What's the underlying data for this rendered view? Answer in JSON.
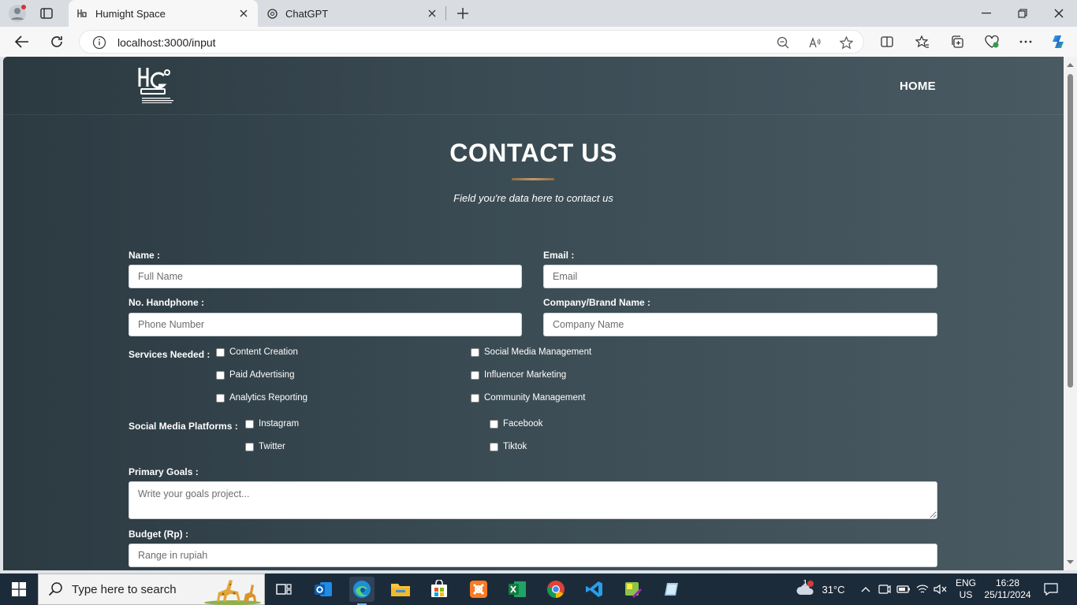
{
  "browser": {
    "tabs": [
      {
        "title": "Humight Space",
        "active": true
      },
      {
        "title": "ChatGPT",
        "active": false
      }
    ],
    "address": "localhost:3000/input"
  },
  "site": {
    "nav_home": "HOME",
    "title": "CONTACT US",
    "subtitle": "Field you're data here to contact us"
  },
  "form": {
    "name_label": "Name :",
    "name_placeholder": "Full Name",
    "email_label": "Email :",
    "email_placeholder": "Email",
    "phone_label": "No. Handphone :",
    "phone_placeholder": "Phone Number",
    "company_label": "Company/Brand Name :",
    "company_placeholder": "Company Name",
    "services_label": "Services Needed :",
    "services": [
      {
        "label": "Content Creation",
        "checked": false
      },
      {
        "label": "Social Media Management",
        "checked": false
      },
      {
        "label": "Paid Advertising",
        "checked": false
      },
      {
        "label": "Influencer Marketing",
        "checked": false
      },
      {
        "label": "Analytics Reporting",
        "checked": false
      },
      {
        "label": "Community Management",
        "checked": false
      }
    ],
    "platforms_label": "Social Media Platforms :",
    "platforms": [
      {
        "label": "Instagram",
        "checked": false
      },
      {
        "label": "Facebook",
        "checked": false
      },
      {
        "label": "Twitter",
        "checked": false
      },
      {
        "label": "Tiktok",
        "checked": false
      }
    ],
    "goals_label": "Primary Goals :",
    "goals_placeholder": "Write your goals project...",
    "budget_label": "Budget (Rp) :",
    "budget_placeholder": "Range in rupiah"
  },
  "taskbar": {
    "search_placeholder": "Type here to search",
    "weather": "31°C",
    "weather_badge": "1",
    "lang_top": "ENG",
    "lang_bottom": "US",
    "time": "16:28",
    "date": "25/11/2024"
  },
  "colors": {
    "page_bg": "#3a4b53",
    "accent_underline": "#c29b6b",
    "taskbar": "#1c2b3a"
  }
}
